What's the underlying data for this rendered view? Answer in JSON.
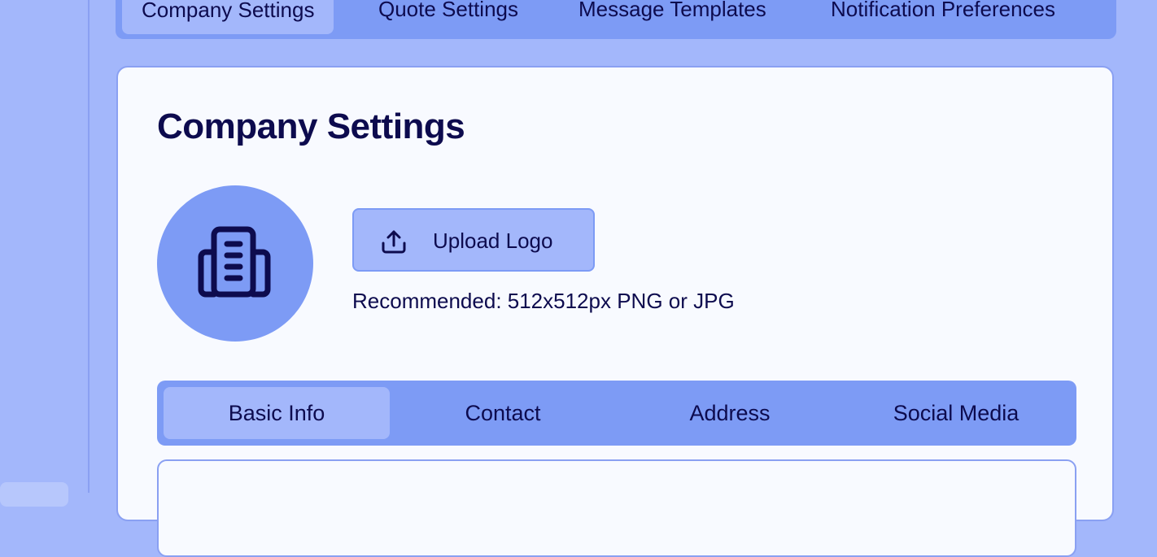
{
  "top_tabs": [
    {
      "label": "Company Settings",
      "active": true
    },
    {
      "label": "Quote Settings",
      "active": false
    },
    {
      "label": "Message Templates",
      "active": false
    },
    {
      "label": "Notification Preferences",
      "active": false
    }
  ],
  "card": {
    "title": "Company Settings",
    "logo_icon": "building-icon",
    "upload": {
      "icon": "upload-icon",
      "label": "Upload Logo"
    },
    "hint": "Recommended: 512x512px PNG or JPG"
  },
  "sub_tabs": [
    {
      "label": "Basic Info",
      "active": true
    },
    {
      "label": "Contact",
      "active": false
    },
    {
      "label": "Address",
      "active": false
    },
    {
      "label": "Social Media",
      "active": false
    }
  ],
  "colors": {
    "background": "#a3b7fb",
    "accent": "#7d9bf5",
    "card": "#f8faff",
    "text": "#0d0b4e",
    "border": "#8aa0f2"
  }
}
